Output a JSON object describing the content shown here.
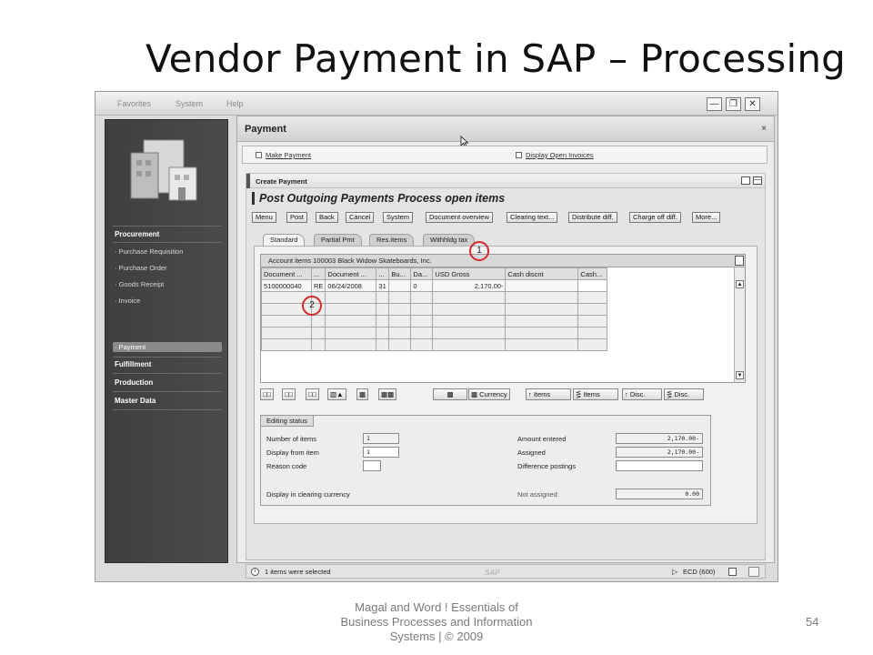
{
  "slide": {
    "title": "Vendor Payment in SAP – Processing",
    "footer_line1": "Magal and Word ! Essentials of",
    "footer_line2": "Business Processes and Information",
    "footer_line3": "Systems | © 2009",
    "page_number": "54"
  },
  "menubar": {
    "items": [
      "Favorites",
      "System",
      "Help"
    ]
  },
  "sidebar": {
    "sections": [
      {
        "label": "Procurement",
        "items": [
          "Purchase Requisition",
          "Purchase Order",
          "Goods Receipt",
          "Invoice",
          "Payment"
        ]
      },
      {
        "label": "Fulfillment"
      },
      {
        "label": "Production"
      },
      {
        "label": "Master Data"
      }
    ],
    "selected": "Payment"
  },
  "payment_window": {
    "title": "Payment",
    "close": "×",
    "links": [
      "Make Payment",
      "Display Open Invoices"
    ]
  },
  "create_payment": {
    "header": "Create Payment",
    "title": "Post Outgoing Payments Process open items",
    "toolbar": [
      "Menu",
      "Post",
      "Back",
      "Cancel",
      "System",
      "Document overview",
      "Clearing text...",
      "Distribute diff.",
      "Charge off diff.",
      "More..."
    ],
    "tabs": [
      "Standard",
      "Partial Pmt",
      "Res.items",
      "Withhldg tax"
    ],
    "active_tab": "Standard"
  },
  "account_items": {
    "title": "Account items 100003 Black Widow Skateboards, Inc.",
    "columns": [
      "Document ...",
      "...",
      "Document ...",
      "...",
      "Bu...",
      "Da...",
      "USD Gross",
      "Cash discnt",
      "Cash..."
    ],
    "rows": [
      [
        "5100000040",
        "RE",
        "06/24/2008",
        "31",
        "",
        "0",
        "2,170.00-",
        "",
        ""
      ]
    ],
    "empty_rows": 5
  },
  "callouts": [
    "1",
    "2"
  ],
  "item_buttons": [
    "Currency",
    "Items",
    "Items",
    "Disc.",
    "Disc."
  ],
  "editing_status": {
    "title": "Editing status",
    "number_of_items_label": "Number of items",
    "number_of_items": "1",
    "display_from_item_label": "Display from item",
    "display_from_item": "1",
    "reason_code_label": "Reason code",
    "reason_code": "",
    "display_clearing_label": "Display in clearing currency",
    "amount_entered_label": "Amount entered",
    "amount_entered": "2,170.00-",
    "assigned_label": "Assigned",
    "assigned": "2,170.00-",
    "difference_label": "Difference postings",
    "difference": "",
    "not_assigned_label": "Not assigned",
    "not_assigned": "0.00"
  },
  "status_bar": {
    "message": "1 items were selected",
    "system": "ECD (600)"
  },
  "brand": {
    "sap": "SAP"
  }
}
